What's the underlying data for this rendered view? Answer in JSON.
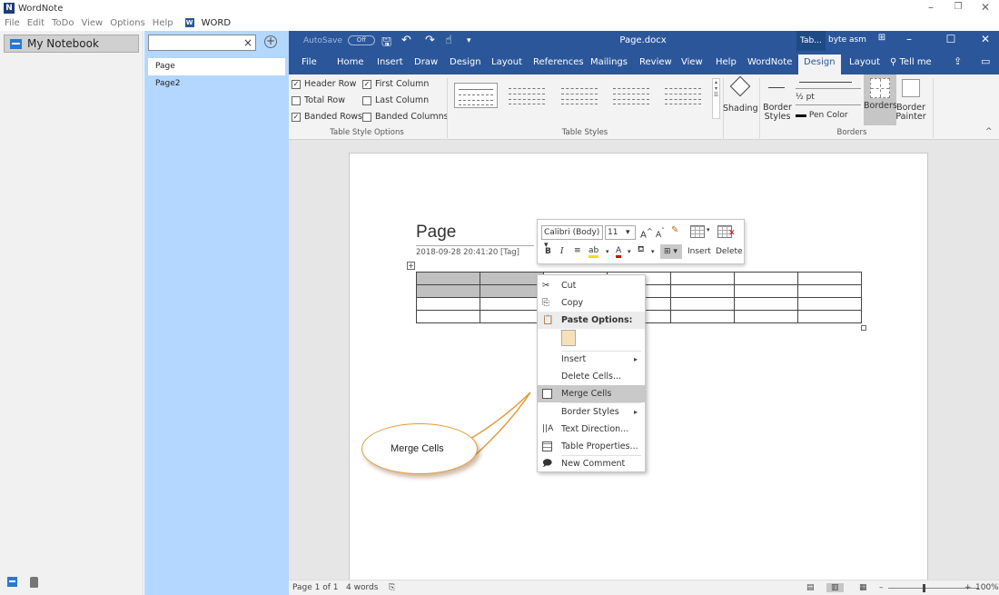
{
  "app": {
    "title": "WordNote",
    "menu": [
      "File",
      "Edit",
      "ToDo",
      "View",
      "Options",
      "Help"
    ],
    "word_tag": "WORD",
    "word_icon_letter": "W",
    "logo_letter": "N"
  },
  "notebook": {
    "name": "My Notebook"
  },
  "pages": {
    "search_placeholder": "",
    "clear": "×",
    "add": "+",
    "items": [
      "Page",
      "Page2"
    ]
  },
  "word": {
    "autosave_label": "AutoSave",
    "autosave_state": "Off",
    "doc_title": "Page.docx",
    "tab_tools": "Tab...",
    "user": "byte asm",
    "ribbon_tabs": [
      "File",
      "Home",
      "Insert",
      "Draw",
      "Design",
      "Layout",
      "References",
      "Mailings",
      "Review",
      "View",
      "Help",
      "WordNote",
      "Design",
      "Layout",
      "Tell me"
    ],
    "active_tab": "Design",
    "table_style_options": {
      "col1": [
        {
          "label": "Header Row",
          "checked": true
        },
        {
          "label": "Total Row",
          "checked": false
        },
        {
          "label": "Banded Rows",
          "checked": true
        }
      ],
      "col2": [
        {
          "label": "First Column",
          "checked": true
        },
        {
          "label": "Last Column",
          "checked": false
        },
        {
          "label": "Banded Columns",
          "checked": false
        }
      ],
      "group_label": "Table Style Options"
    },
    "table_styles_label": "Table Styles",
    "shading_label": "Shading",
    "border_styles_label": [
      "Border",
      "Styles"
    ],
    "pen_weight": "½ pt",
    "pen_color_label": "Pen Color",
    "borders_label": "Borders",
    "border_painter_label": [
      "Border",
      "Painter"
    ],
    "borders_group_label": "Borders"
  },
  "document": {
    "heading": "Page",
    "meta": "2018-09-28 20:41:20  [Tag]",
    "table": {
      "rows": 4,
      "cols": 7
    }
  },
  "mini_toolbar": {
    "font": "Calibri (Body)",
    "size": "11",
    "insert_label": "Insert",
    "delete_label": "Delete"
  },
  "context_menu": {
    "items": [
      {
        "label": "Cut",
        "icon": "scissors-icon"
      },
      {
        "label": "Copy",
        "icon": "copy-icon"
      },
      {
        "label": "Paste Options:",
        "icon": "paste-icon"
      },
      {
        "label": "Insert",
        "icon": "",
        "submenu": true
      },
      {
        "label": "Delete Cells...",
        "icon": ""
      },
      {
        "label": "Merge Cells",
        "icon": "merge-cells-icon"
      },
      {
        "label": "Border Styles",
        "icon": "",
        "submenu": true
      },
      {
        "label": "Text Direction...",
        "icon": "text-direction-icon"
      },
      {
        "label": "Table Properties...",
        "icon": "table-properties-icon"
      },
      {
        "label": "New Comment",
        "icon": "comment-icon"
      }
    ],
    "hovered": "Merge Cells"
  },
  "callout": {
    "text": "Merge Cells"
  },
  "status": {
    "page": "Page 1 of 1",
    "words": "4 words",
    "zoom": "100%"
  },
  "colors": {
    "word_blue": "#2b579a",
    "page_list_bg": "#b4d7ff",
    "callout_border": "#e39a3a"
  }
}
